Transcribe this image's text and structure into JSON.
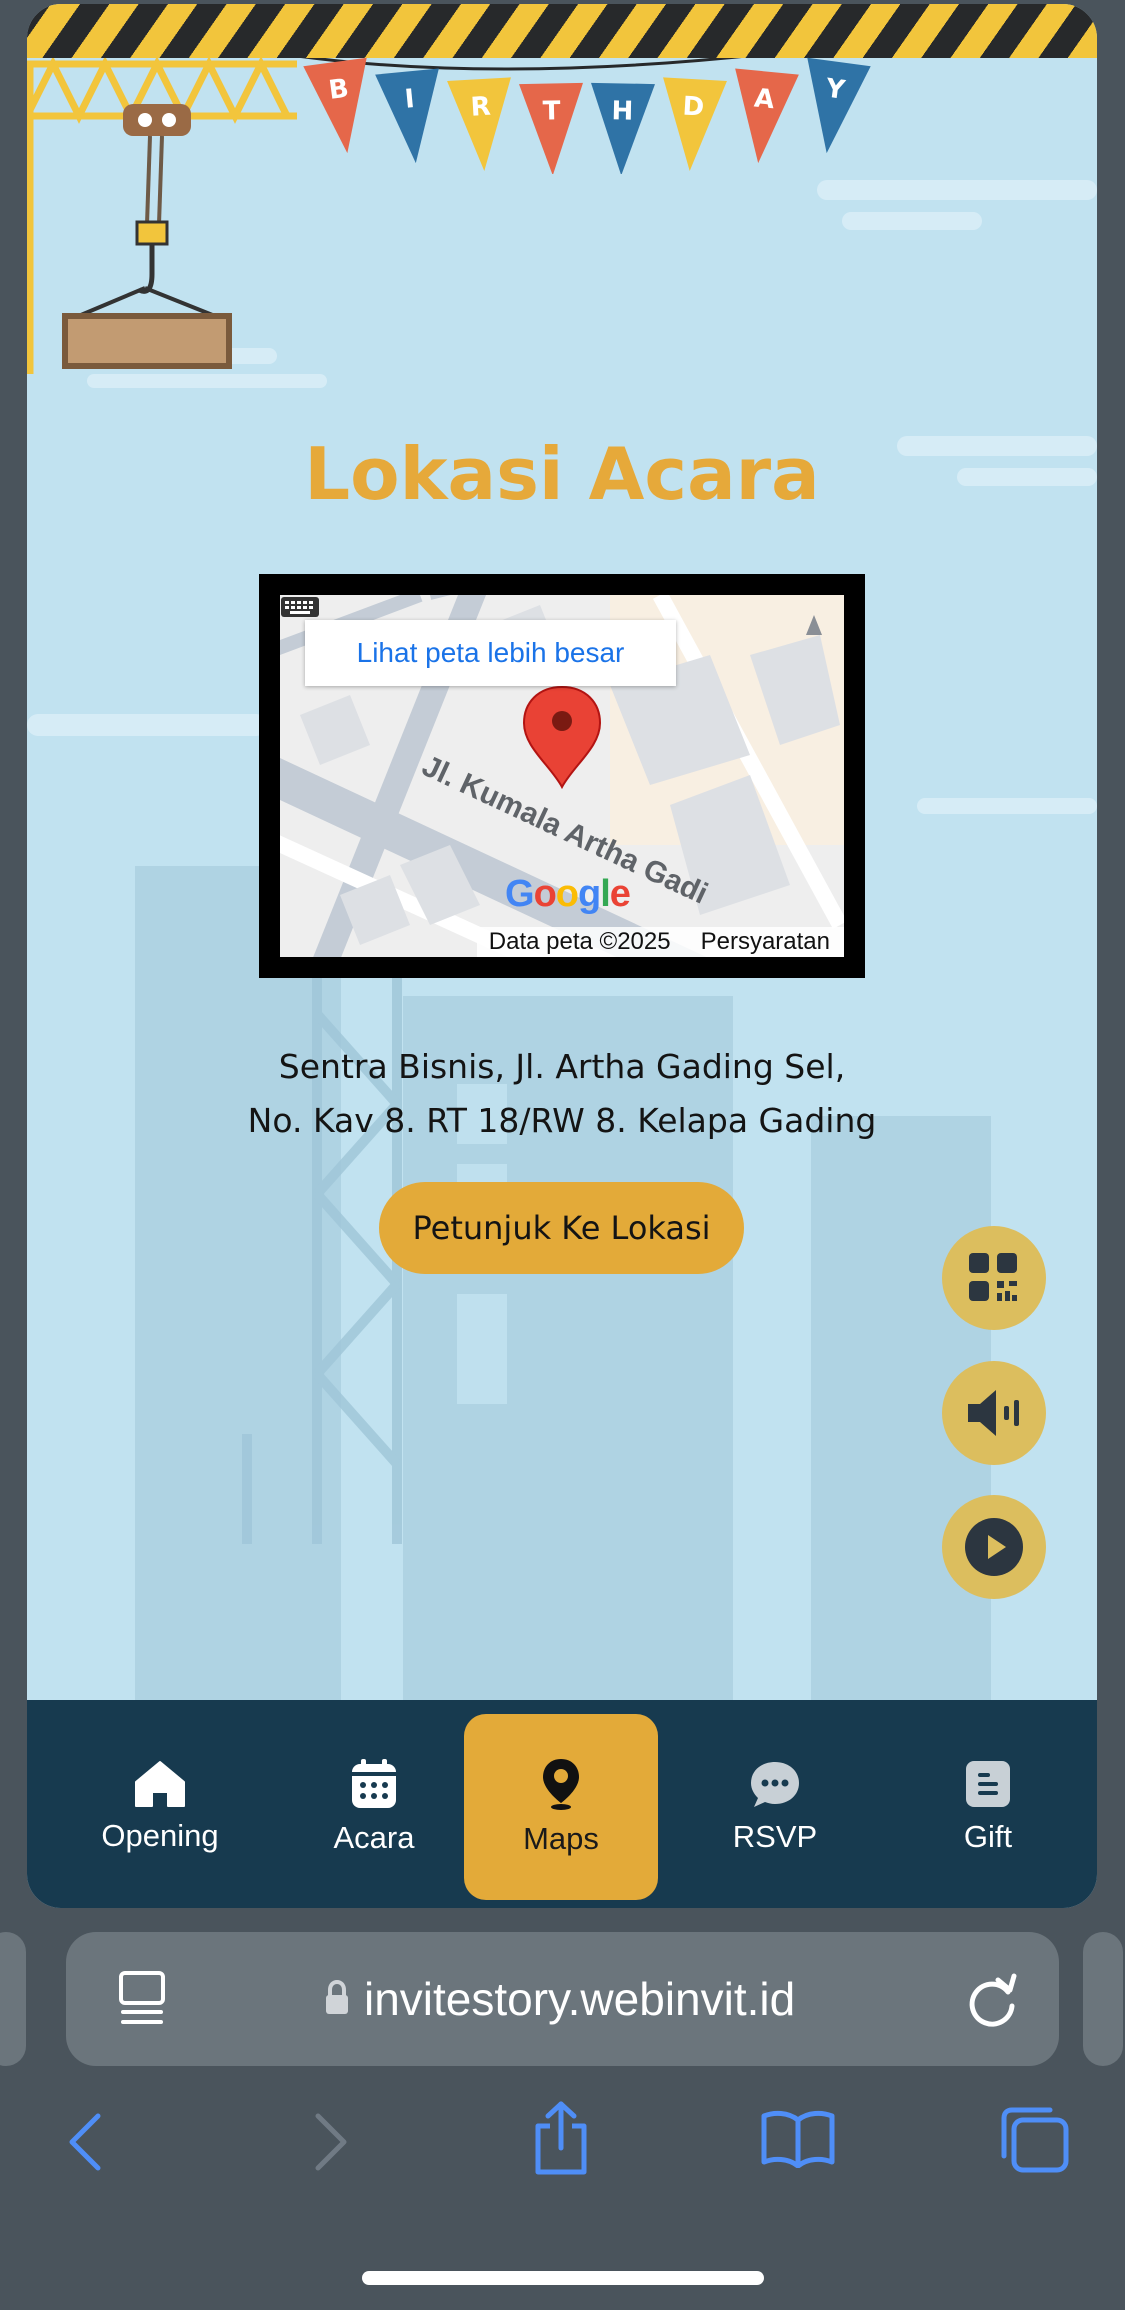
{
  "banner": {
    "letters": [
      "B",
      "I",
      "R",
      "T",
      "H",
      "D",
      "A",
      "Y"
    ],
    "colors": [
      "#e5674a",
      "#2f73a6",
      "#f2c53c",
      "#e5674a",
      "#2f73a6",
      "#f2c53c",
      "#e5674a",
      "#2f73a6"
    ]
  },
  "section": {
    "title": "Lokasi Acara"
  },
  "map": {
    "view_larger": "Lihat peta lebih besar",
    "street_label": "Jl. Kumala Artha Gadi",
    "map_data": "Data peta ©2025",
    "terms": "Persyaratan"
  },
  "address": {
    "line1": "Sentra Bisnis, Jl. Artha Gading Sel,",
    "line2": "No. Kav 8. RT 18/RW 8. Kelapa Gading"
  },
  "directions_button": "Petunjuk Ke Lokasi",
  "fabs": [
    "qr-code-icon",
    "speaker-icon",
    "play-icon"
  ],
  "nav": {
    "items": [
      {
        "label": "Opening",
        "icon": "home-icon"
      },
      {
        "label": "Acara",
        "icon": "calendar-icon"
      },
      {
        "label": "Maps",
        "icon": "map-pin-icon",
        "active": true
      },
      {
        "label": "RSVP",
        "icon": "chat-bubble-icon"
      },
      {
        "label": "Gift",
        "icon": "gift-list-icon"
      }
    ]
  },
  "browser": {
    "url": "invitestory.webinvit.id"
  },
  "colors": {
    "accent": "#e3aa39",
    "title": "#e6a93a",
    "nav_bg": "#173a4f",
    "card_bg": "#c1e2f0"
  }
}
